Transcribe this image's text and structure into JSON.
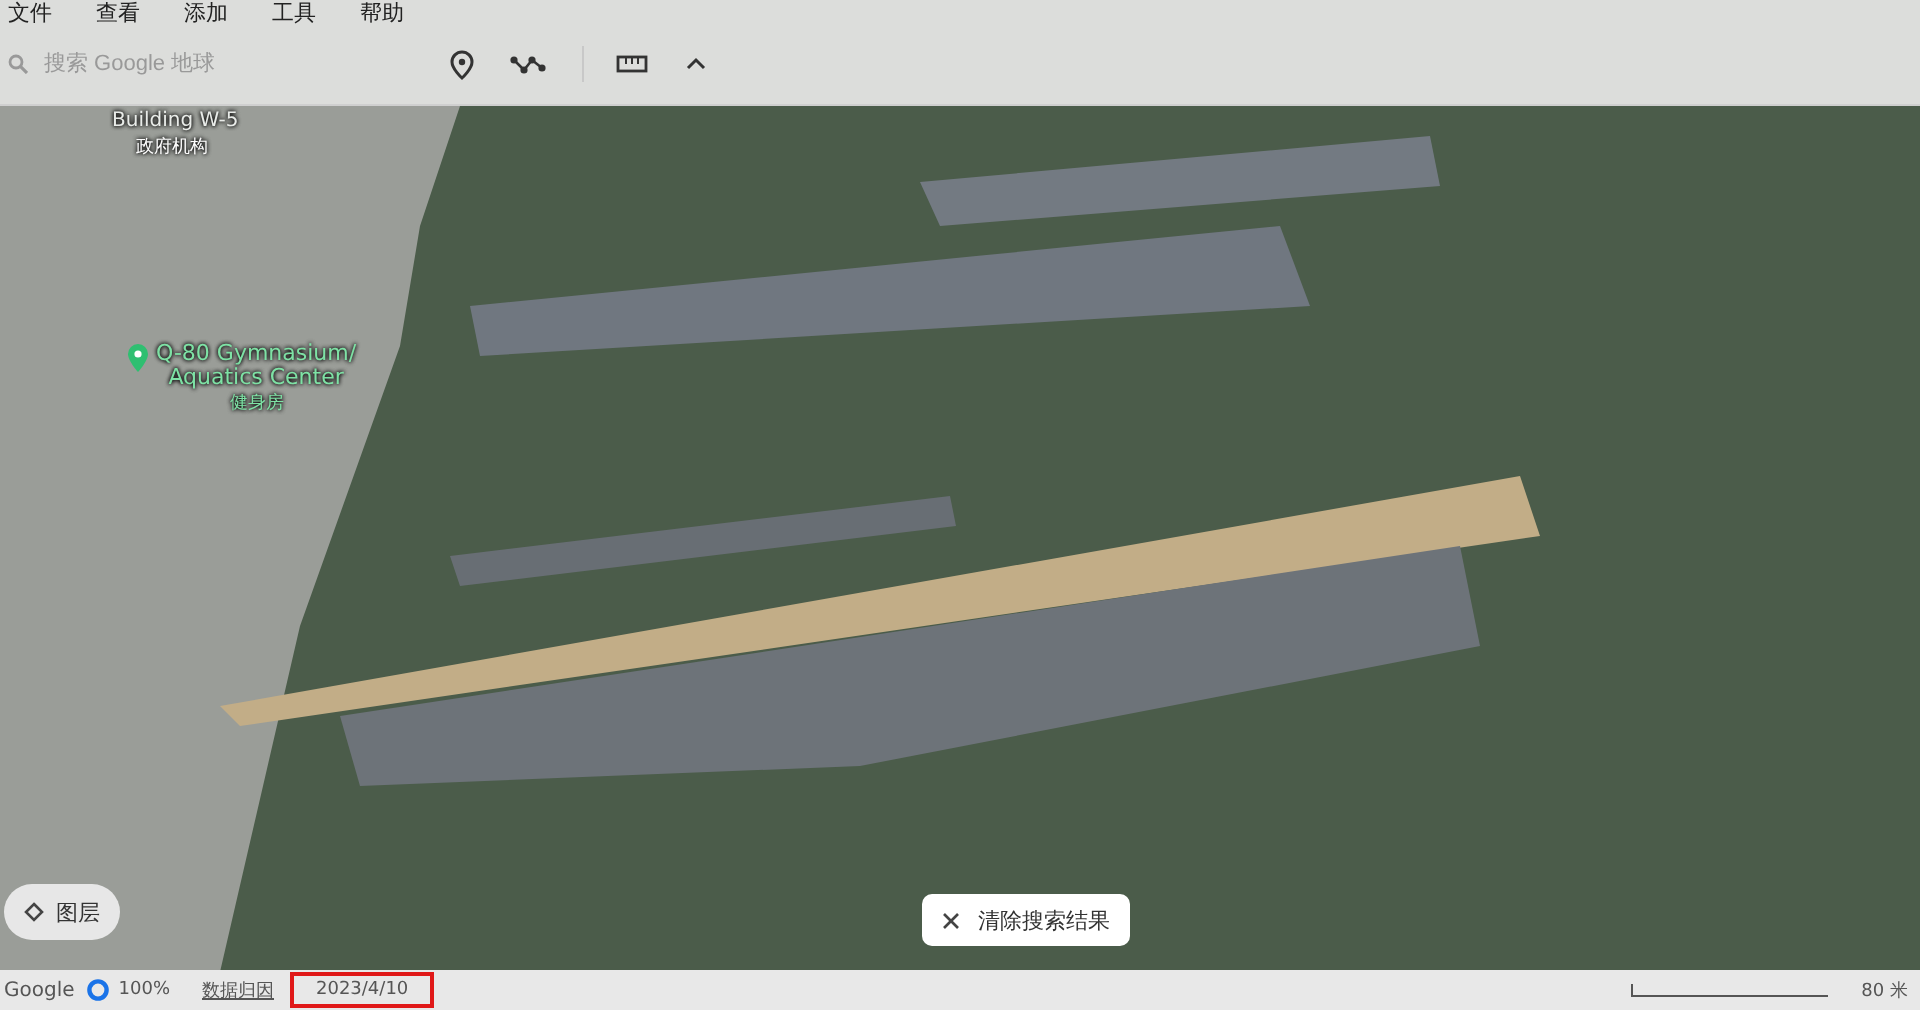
{
  "menu": [
    "文件",
    "查看",
    "添加",
    "工具",
    "帮助"
  ],
  "search": {
    "placeholder": "搜索 Google 地球"
  },
  "map_labels": [
    {
      "kind": "faded",
      "text": "Building W-5"
    },
    {
      "kind": "plain",
      "text": "政府机构"
    },
    {
      "kind": "pin",
      "text": "Q-80 Gymnasium/\nAquatics Center"
    },
    {
      "kind": "category",
      "text": "健身房"
    }
  ],
  "layers_button": "图层",
  "clear_search_button": "清除搜索结果",
  "status_bar": {
    "logo": "Google",
    "loading": "100%",
    "attribution": "数据归因",
    "imagery_date": {
      "text": "2023/4/10",
      "highlighted": true
    },
    "scale": "80 米"
  }
}
